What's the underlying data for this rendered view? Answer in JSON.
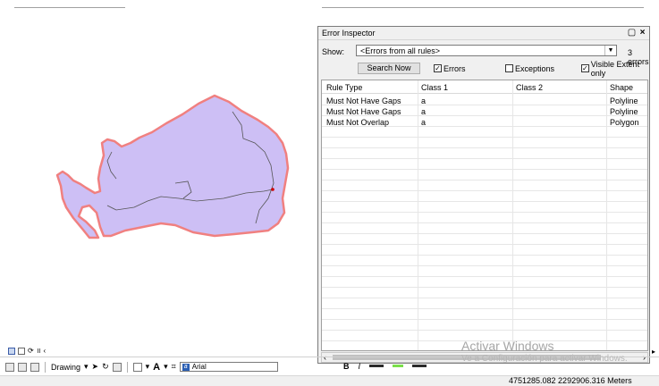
{
  "error_inspector": {
    "title": "Error Inspector",
    "restore_icon": "restore-icon",
    "close_icon": "close-icon",
    "show_label": "Show:",
    "rules_filter": "<Errors from all rules>",
    "error_count": "3 errors",
    "search_button": "Search Now",
    "checkboxes": {
      "errors": {
        "label": "Errors",
        "checked": true
      },
      "exceptions": {
        "label": "Exceptions",
        "checked": false
      },
      "visible_extent": {
        "label": "Visible Extent only",
        "checked": true
      }
    },
    "columns": [
      "Rule Type",
      "Class 1",
      "Class 2",
      "Shape"
    ],
    "rows": [
      [
        "Must Not Have Gaps",
        "a",
        "",
        "Polyline"
      ],
      [
        "Must Not Have Gaps",
        "a",
        "",
        "Polyline"
      ],
      [
        "Must Not Overlap",
        "a",
        "",
        "Polygon"
      ]
    ]
  },
  "drawing_toolbar": {
    "drawing_label": "Drawing",
    "font_name": "Arial"
  },
  "status_bar": {
    "coordinates": "4751285.082  2292906.316 Meters"
  },
  "watermark": {
    "line1": "Activar Windows",
    "line2": "Ve a Configuración para activar Windows."
  },
  "colors": {
    "polygon_fill": "#cdbff5",
    "polygon_outline": "#f08080",
    "inner_lines": "#555555"
  }
}
